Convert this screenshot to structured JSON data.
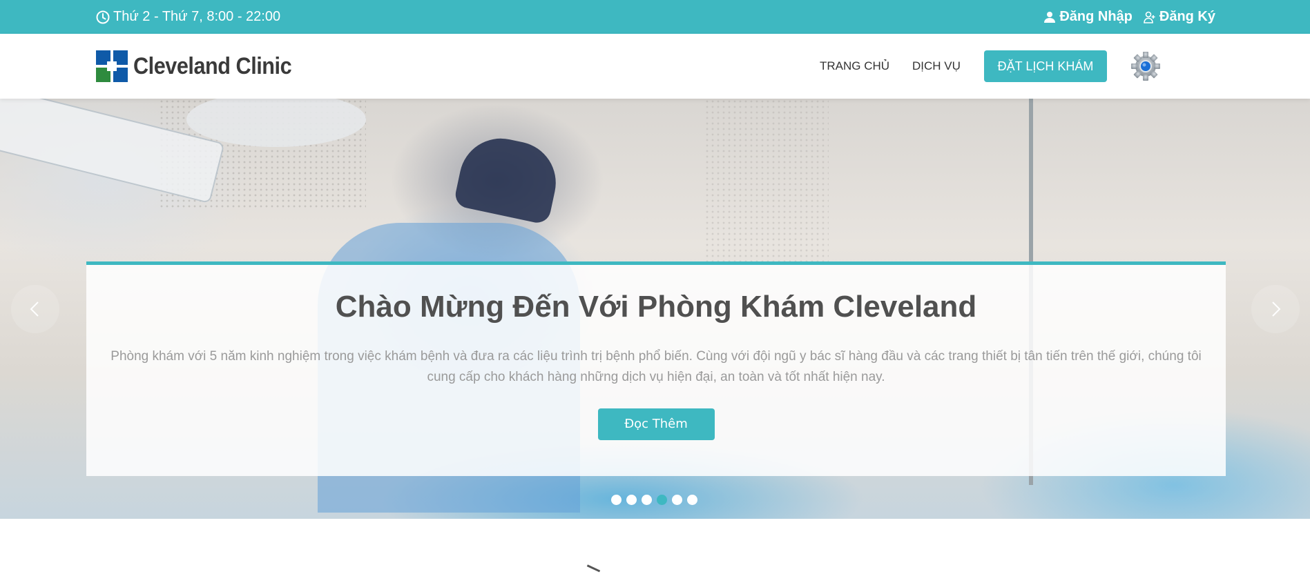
{
  "topbar": {
    "hours": "Thứ 2 - Thứ 7, 8:00 - 22:00",
    "login": "Đăng Nhập",
    "register": "Đăng Ký",
    "background_color": "#3eb8c1"
  },
  "navbar": {
    "logo_text": "Cleveland Clinic",
    "home": "TRANG CHỦ",
    "services": "DỊCH VỤ",
    "book_button": "ĐẶT LỊCH KHÁM",
    "settings_icon": "gear-icon"
  },
  "hero": {
    "title": "Chào Mừng Đến Với Phòng Khám Cleveland",
    "description": "Phòng khám với 5 năm kinh nghiệm trong việc khám bệnh và đưa ra các liệu trình trị bệnh phổ biến. Cùng với đội ngũ y bác sĩ hàng đầu và các trang thiết bị tân tiến trên thế giới, chúng tôi cung cấp cho khách hàng những dịch vụ hiện đại, an toàn và tốt nhất hiện nay.",
    "read_more": "Đọc Thêm",
    "slides_count": 6,
    "active_slide_index": 3,
    "accent_color": "#3eb8c1"
  }
}
